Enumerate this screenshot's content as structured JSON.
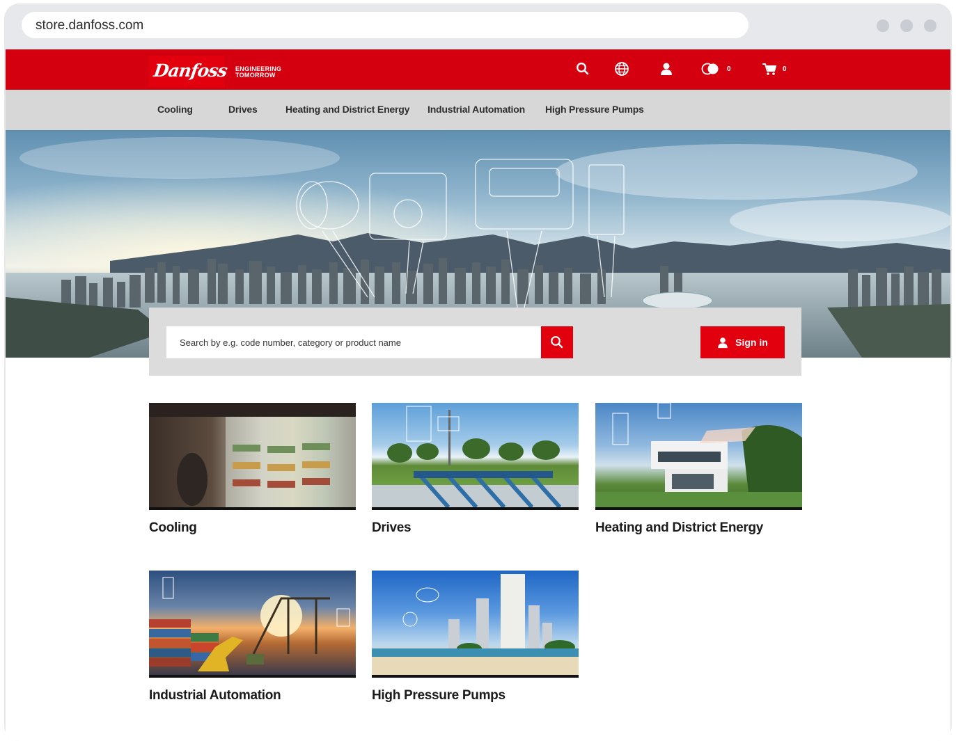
{
  "browser": {
    "url": "store.danfoss.com"
  },
  "header": {
    "logo_text": "Danfoss",
    "tagline_line1": "ENGINEERING",
    "tagline_line2": "TOMORROW",
    "compare_count": "0",
    "cart_count": "0",
    "icons": [
      "search-icon",
      "globe-icon",
      "user-icon",
      "compare-icon",
      "cart-icon"
    ],
    "brand_color": "#d4000f"
  },
  "nav": {
    "items": [
      {
        "label": "Cooling"
      },
      {
        "label": "Drives"
      },
      {
        "label": "Heating and District Energy"
      },
      {
        "label": "Industrial Automation"
      },
      {
        "label": "High Pressure Pumps"
      }
    ]
  },
  "search": {
    "placeholder": "Search by e.g. code number, category or product name",
    "signin_label": "Sign in"
  },
  "categories": [
    {
      "label": "Cooling"
    },
    {
      "label": "Drives"
    },
    {
      "label": "Heating and District Energy"
    },
    {
      "label": "Industrial Automation"
    },
    {
      "label": "High Pressure Pumps"
    }
  ]
}
